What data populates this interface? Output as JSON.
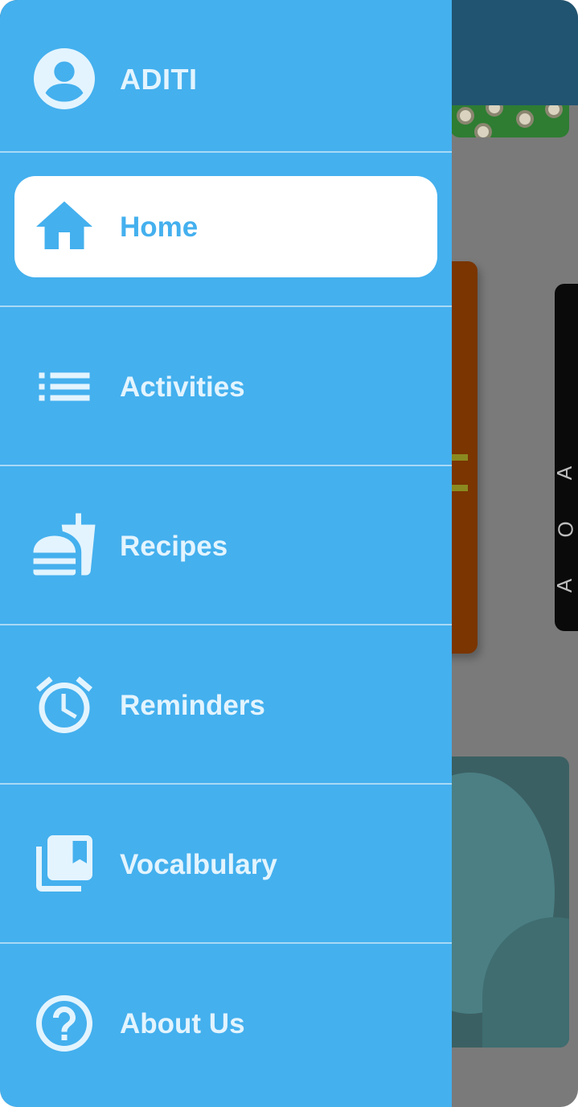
{
  "drawer": {
    "user": {
      "name": "ADITI",
      "icon": "account-circle-icon"
    },
    "items": [
      {
        "label": "Home",
        "icon": "home-icon",
        "active": true
      },
      {
        "label": "Activities",
        "icon": "list-icon",
        "active": false
      },
      {
        "label": "Recipes",
        "icon": "fastfood-icon",
        "active": false
      },
      {
        "label": "Reminders",
        "icon": "alarm-icon",
        "active": false
      },
      {
        "label": "Vocalbulary",
        "icon": "library-books-icon",
        "active": false
      },
      {
        "label": "About Us",
        "icon": "help-circle-icon",
        "active": false
      }
    ]
  },
  "colors": {
    "drawer_background": "#44b0ee",
    "drawer_text": "#e3f4fe",
    "active_item_background": "#ffffff",
    "active_item_text": "#44b0ee",
    "scrim": "#7a7a7a",
    "app_bar_dimmed": "#215470"
  }
}
